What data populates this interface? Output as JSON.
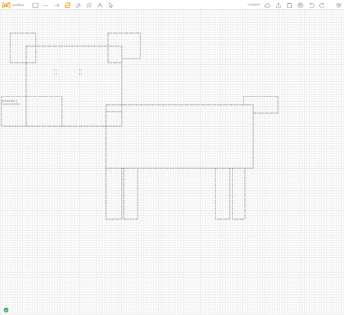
{
  "app": {
    "logo_mark": "[af]",
    "logo_text": "ascilflow",
    "status": "Unsaved"
  },
  "colors": {
    "accent": "#f29100",
    "icon": "#9a9a9a",
    "line": "#555555",
    "grid": "#ececec"
  },
  "toolbar": {
    "tools": [
      "rectangle-icon",
      "line-icon",
      "arrow-icon",
      "freeform-icon",
      "eraser-icon",
      "draw-icon",
      "text-icon",
      "select-icon"
    ],
    "actions": [
      "cloud-icon",
      "export-icon",
      "import-icon",
      "help-icon",
      "undo-icon",
      "redo-icon"
    ],
    "settings": "gear-icon"
  },
  "drawing": {
    "eyes": [
      "**",
      "**",
      "**",
      "**"
    ],
    "mouth": "□□□□□□□|"
  }
}
